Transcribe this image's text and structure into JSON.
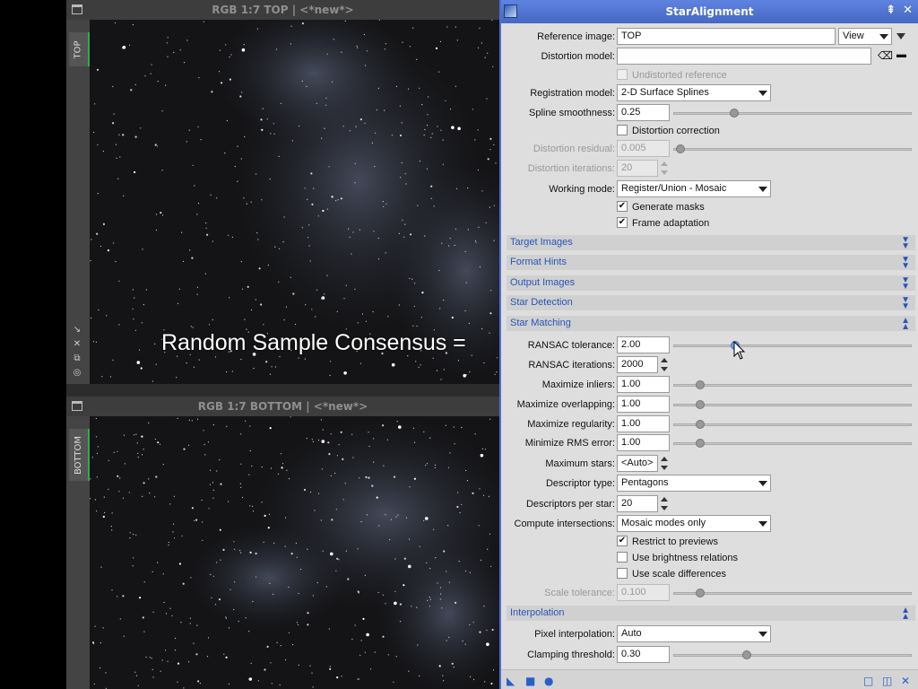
{
  "top_window": {
    "title": "RGB 1:7 TOP | <*new*>",
    "tab": "TOP"
  },
  "bottom_window": {
    "title": "RGB 1:7 BOTTOM | <*new*>",
    "tab": "BOTTOM"
  },
  "overlay_text": "Random Sample Consensus =",
  "dialog": {
    "title": "StarAlignment",
    "reference_image_label": "Reference image:",
    "reference_image_value": "TOP",
    "view_button": "View",
    "distortion_model_label": "Distortion model:",
    "distortion_model_value": "",
    "undistorted_reference": "Undistorted reference",
    "registration_model_label": "Registration model:",
    "registration_model_value": "2-D Surface Splines",
    "spline_smoothness_label": "Spline smoothness:",
    "spline_smoothness_value": "0.25",
    "distortion_correction": "Distortion correction",
    "distortion_residual_label": "Distortion residual:",
    "distortion_residual_value": "0.005",
    "distortion_iterations_label": "Distortion iterations:",
    "distortion_iterations_value": "20",
    "working_mode_label": "Working mode:",
    "working_mode_value": "Register/Union - Mosaic",
    "generate_masks": "Generate masks",
    "frame_adaptation": "Frame adaptation",
    "sections": {
      "target_images": "Target Images",
      "format_hints": "Format Hints",
      "output_images": "Output Images",
      "star_detection": "Star Detection",
      "star_matching": "Star Matching",
      "interpolation": "Interpolation"
    },
    "ransac_tolerance_label": "RANSAC tolerance:",
    "ransac_tolerance_value": "2.00",
    "ransac_iterations_label": "RANSAC iterations:",
    "ransac_iterations_value": "2000",
    "maximize_inliers_label": "Maximize inliers:",
    "maximize_inliers_value": "1.00",
    "maximize_overlapping_label": "Maximize overlapping:",
    "maximize_overlapping_value": "1.00",
    "maximize_regularity_label": "Maximize regularity:",
    "maximize_regularity_value": "1.00",
    "minimize_rms_label": "Minimize RMS error:",
    "minimize_rms_value": "1.00",
    "maximum_stars_label": "Maximum stars:",
    "maximum_stars_value": "<Auto>",
    "descriptor_type_label": "Descriptor type:",
    "descriptor_type_value": "Pentagons",
    "descriptors_per_star_label": "Descriptors per star:",
    "descriptors_per_star_value": "20",
    "compute_intersections_label": "Compute intersections:",
    "compute_intersections_value": "Mosaic modes only",
    "restrict_to_previews": "Restrict to previews",
    "use_brightness_relations": "Use brightness relations",
    "use_scale_differences": "Use scale differences",
    "scale_tolerance_label": "Scale tolerance:",
    "scale_tolerance_value": "0.100",
    "pixel_interpolation_label": "Pixel interpolation:",
    "pixel_interpolation_value": "Auto",
    "clamping_threshold_label": "Clamping threshold:",
    "clamping_threshold_value": "0.30"
  },
  "colors": {
    "accent": "#4a6fd6",
    "section_text": "#2854b8",
    "tab_green": "#2bb04a"
  }
}
